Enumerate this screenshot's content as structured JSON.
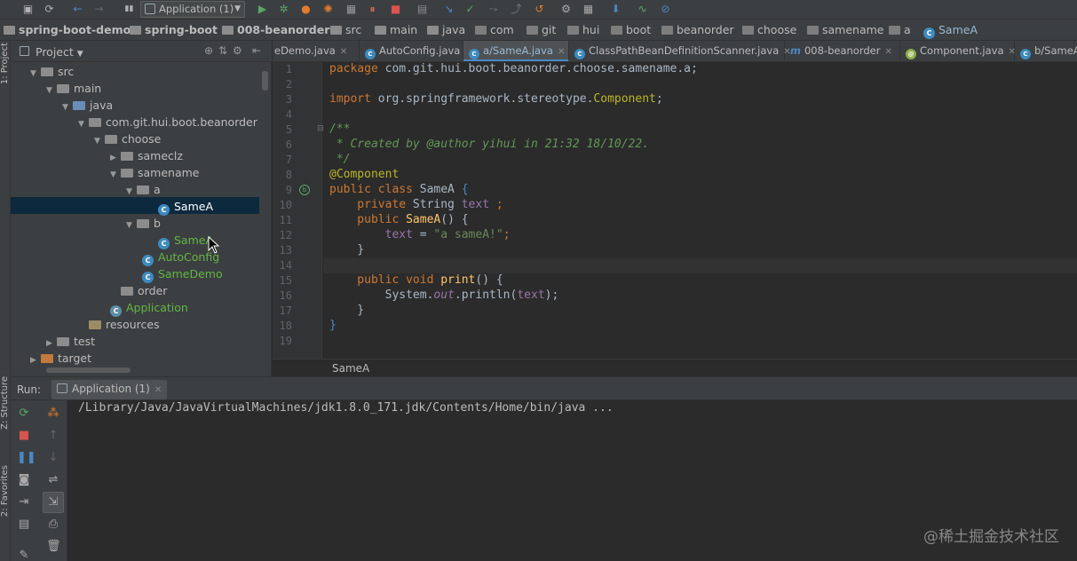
{
  "toolbar": {
    "run_config": "Application (1)",
    "icons": [
      "save-icon",
      "sync-icon",
      "back-icon",
      "forward-icon",
      "build-icon",
      "run-icon",
      "debug-icon",
      "coverage-icon",
      "profile-icon",
      "stop-icon",
      "vcs-icon",
      "settings-icon",
      "structure-icon",
      "search-icon"
    ]
  },
  "breadcrumb": {
    "items": [
      "spring-boot-demo",
      "spring-boot",
      "008-beanorder",
      "src",
      "main",
      "java",
      "com",
      "git",
      "hui",
      "boot",
      "beanorder",
      "choose",
      "samename",
      "a",
      "SameA"
    ]
  },
  "left_strip": {
    "project": "1: Project",
    "structure": "Z: Structure",
    "favorites": "2: Favorites"
  },
  "project": {
    "title": "Project",
    "tree": [
      {
        "label": "src",
        "expanded": true
      },
      {
        "label": "main",
        "expanded": true
      },
      {
        "label": "java",
        "expanded": true
      },
      {
        "label": "com.git.hui.boot.beanorder",
        "expanded": true
      },
      {
        "label": "choose",
        "expanded": true
      },
      {
        "label": "sameclz",
        "expanded": false
      },
      {
        "label": "samename",
        "expanded": true
      },
      {
        "label": "a",
        "expanded": true
      },
      {
        "label": "SameA",
        "selected": true
      },
      {
        "label": "b",
        "expanded": true
      },
      {
        "label": "SameA"
      },
      {
        "label": "AutoConfig"
      },
      {
        "label": "SameDemo"
      },
      {
        "label": "order"
      },
      {
        "label": "Application"
      },
      {
        "label": "resources"
      },
      {
        "label": "test",
        "expanded": false
      },
      {
        "label": "target",
        "expanded": false
      }
    ]
  },
  "editor_tabs": [
    {
      "label": "eDemo.java"
    },
    {
      "label": "AutoConfig.java"
    },
    {
      "label": "a/SameA.java",
      "active": true
    },
    {
      "label": "ClassPathBeanDefinitionScanner.java"
    },
    {
      "label": "008-beanorder"
    },
    {
      "label": "Component.java"
    },
    {
      "label": "b/SameA"
    }
  ],
  "editor": {
    "line_numbers": [
      "1",
      "2",
      "3",
      "4",
      "5",
      "6",
      "7",
      "8",
      "9",
      "10",
      "11",
      "12",
      "13",
      "14",
      "15",
      "16",
      "17",
      "18",
      "19"
    ],
    "code": {
      "l1_kw": "package",
      "l1_rest": " com.git.hui.boot.beanorder.choose.samename.a;",
      "l3_kw": "import",
      "l3_pkg": " org.springframework.stereotype.",
      "l3_cls": "Component",
      "l3_end": ";",
      "l5": "/**",
      "l6": " * Created by @author yihui in 21:32 18/10/22.",
      "l7": " */",
      "l8": "@Component",
      "l9_kw": "public class",
      "l9_name": " SameA ",
      "l9_brace": "{",
      "l10_kw": "    private",
      "l10_type": " String ",
      "l10_field": "text",
      "l10_end": " ;",
      "l11_kw": "    public",
      "l11_fn": " SameA",
      "l11_end": "() {",
      "l12_indent": "        ",
      "l12_field": "text",
      "l12_eq": " = ",
      "l12_str": "\"a sameA!\"",
      "l12_end": ";",
      "l13": "    }",
      "l15_kw": "    public void",
      "l15_fn": " print",
      "l15_end": "() {",
      "l16_a": "        System.",
      "l16_out": "out",
      "l16_b": ".println(",
      "l16_field": "text",
      "l16_c": ");",
      "l17": "    }",
      "l18": "}"
    },
    "breadcrumb": "SameA"
  },
  "run": {
    "label": "Run:",
    "tab": "Application (1)",
    "console": "/Library/Java/JavaVirtualMachines/jdk1.8.0_171.jdk/Contents/Home/bin/java ..."
  },
  "watermark": "@稀土掘金技术社区",
  "colors": {
    "background": "#2b2b2b",
    "panel": "#3c3f41",
    "keyword": "#cc7832",
    "annotation": "#bbb529",
    "comment": "#629755",
    "string": "#6a8759",
    "field": "#9876aa",
    "selection": "#0d293e"
  }
}
